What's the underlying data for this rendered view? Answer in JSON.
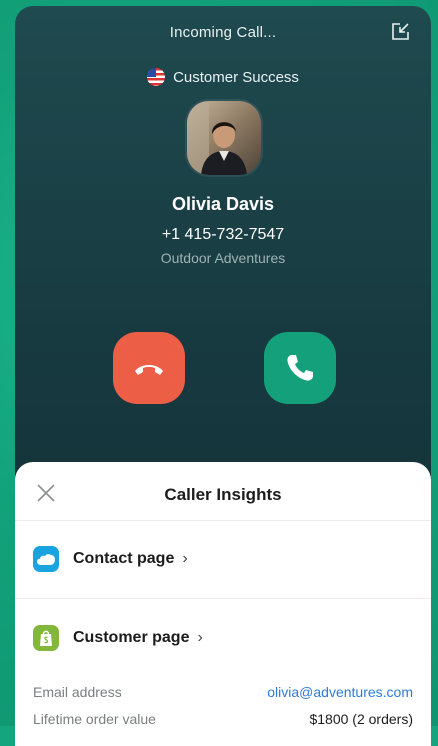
{
  "header": {
    "title": "Incoming Call..."
  },
  "queue": {
    "name": "Customer Success",
    "flag": "us-flag-icon"
  },
  "caller": {
    "name": "Olivia Davis",
    "phone": "+1 415-732-7547",
    "company": "Outdoor Adventures"
  },
  "actions": {
    "decline_icon": "hang-up-icon",
    "accept_icon": "phone-icon"
  },
  "insights": {
    "title": "Caller Insights",
    "links": [
      {
        "label": "Contact page",
        "icon": "salesforce-icon",
        "color": "#19a4e0"
      },
      {
        "label": "Customer page",
        "icon": "shopify-icon",
        "color": "#83b73b"
      }
    ],
    "details": [
      {
        "label": "Email address",
        "value": "olivia@adventures.com"
      },
      {
        "label": "Lifetime order value",
        "value": "$1800 (2 orders)"
      }
    ]
  },
  "colors": {
    "decline": "#ec5e45",
    "accept": "#14a07b",
    "background": "#14a57f"
  }
}
